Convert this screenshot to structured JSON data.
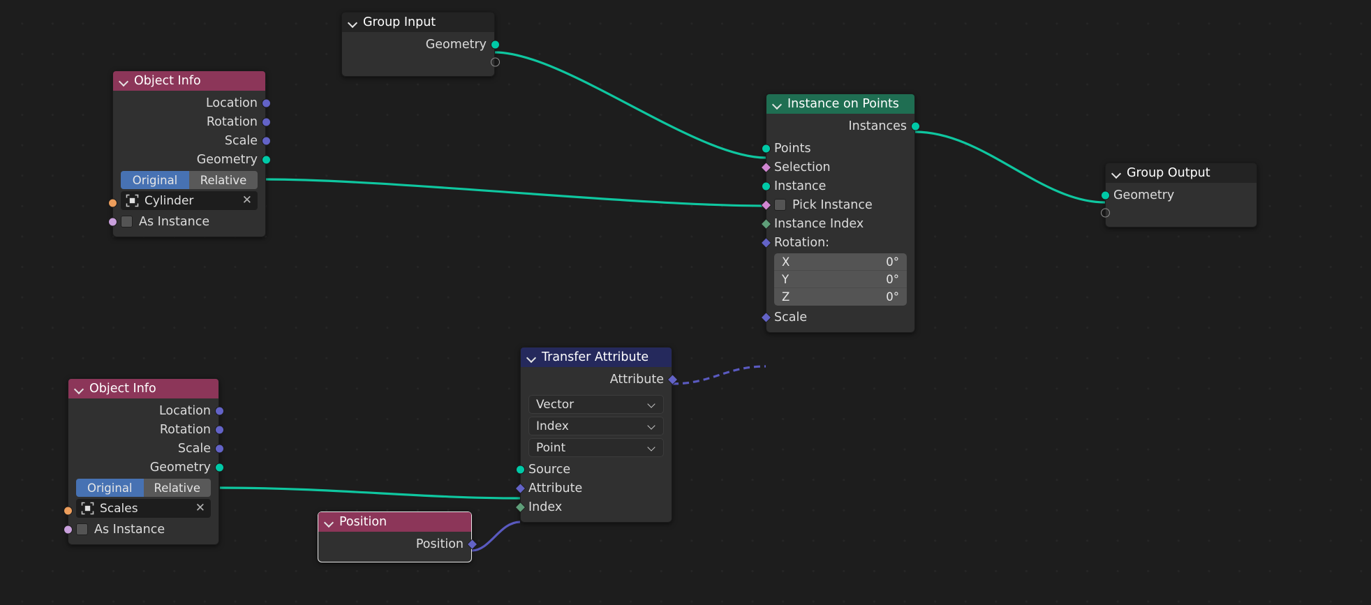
{
  "editor": {
    "name": "Blender Geometry Node Editor",
    "background": "#1d1d1d"
  },
  "colors": {
    "header_input": "#8c3659",
    "header_geometry": "#1f6e52",
    "header_attribute": "#25295c",
    "header_group": "#232323",
    "socket_geometry": "#00c9a7",
    "socket_vector": "#6363c7",
    "socket_field_vector": "#6363c7",
    "socket_bool": "#d186d1",
    "socket_int": "#5f9e79",
    "socket_object": "#ed9e5c",
    "socket_instance": "#c9a0dc",
    "link_geometry": "#0fc7a0",
    "link_field": "#5a5ac0",
    "toggle_active": "#4772b3"
  },
  "nodes": {
    "group_input": {
      "title": "Group Input",
      "outputs": [
        {
          "label": "Geometry",
          "socket": "socket_geometry",
          "shape": "circle"
        },
        {
          "label": "",
          "socket": "ring",
          "shape": "ring"
        }
      ]
    },
    "object_info_top": {
      "title": "Object Info",
      "outputs": [
        {
          "label": "Location",
          "socket": "socket_vector",
          "shape": "circle"
        },
        {
          "label": "Rotation",
          "socket": "socket_vector",
          "shape": "circle"
        },
        {
          "label": "Scale",
          "socket": "socket_vector",
          "shape": "circle"
        },
        {
          "label": "Geometry",
          "socket": "socket_geometry",
          "shape": "circle"
        }
      ],
      "transform_space": {
        "options": [
          "Original",
          "Relative"
        ],
        "selected": "Original"
      },
      "object_field": {
        "icon": "object-icon",
        "value": "Cylinder",
        "clear": "✕",
        "socket": "socket_object"
      },
      "as_instance": {
        "label": "As Instance",
        "checked": false,
        "socket": "socket_instance"
      }
    },
    "object_info_bottom": {
      "title": "Object Info",
      "outputs": [
        {
          "label": "Location",
          "socket": "socket_vector",
          "shape": "circle"
        },
        {
          "label": "Rotation",
          "socket": "socket_vector",
          "shape": "circle"
        },
        {
          "label": "Scale",
          "socket": "socket_vector",
          "shape": "circle"
        },
        {
          "label": "Geometry",
          "socket": "socket_geometry",
          "shape": "circle"
        }
      ],
      "transform_space": {
        "options": [
          "Original",
          "Relative"
        ],
        "selected": "Original"
      },
      "object_field": {
        "icon": "object-icon",
        "value": "Scales",
        "clear": "✕",
        "socket": "socket_object"
      },
      "as_instance": {
        "label": "As Instance",
        "checked": false,
        "socket": "socket_instance"
      }
    },
    "instance_on_points": {
      "title": "Instance on Points",
      "outputs": [
        {
          "label": "Instances",
          "socket": "socket_geometry",
          "shape": "circle"
        }
      ],
      "inputs": [
        {
          "label": "Points",
          "socket": "socket_geometry",
          "shape": "circle"
        },
        {
          "label": "Selection",
          "socket": "socket_bool",
          "shape": "diamond"
        },
        {
          "label": "Instance",
          "socket": "socket_geometry",
          "shape": "circle"
        },
        {
          "label": "Pick Instance",
          "socket": "socket_bool",
          "shape": "diamond",
          "checkbox": false
        },
        {
          "label": "Instance Index",
          "socket": "socket_int",
          "shape": "diamond"
        },
        {
          "label": "Rotation:",
          "socket": "socket_vector",
          "shape": "diamond"
        }
      ],
      "rotation_values": [
        {
          "axis": "X",
          "value": "0°"
        },
        {
          "axis": "Y",
          "value": "0°"
        },
        {
          "axis": "Z",
          "value": "0°"
        }
      ],
      "scale_input": {
        "label": "Scale",
        "socket": "socket_vector",
        "shape": "diamond"
      }
    },
    "transfer_attribute": {
      "title": "Transfer Attribute",
      "outputs": [
        {
          "label": "Attribute",
          "socket": "socket_vector",
          "shape": "diamond"
        }
      ],
      "dropdowns": [
        {
          "name": "data-type",
          "value": "Vector"
        },
        {
          "name": "mapping",
          "value": "Index"
        },
        {
          "name": "domain",
          "value": "Point"
        }
      ],
      "inputs": [
        {
          "label": "Source",
          "socket": "socket_geometry",
          "shape": "circle"
        },
        {
          "label": "Attribute",
          "socket": "socket_vector",
          "shape": "diamond"
        },
        {
          "label": "Index",
          "socket": "socket_int",
          "shape": "diamond"
        }
      ]
    },
    "position": {
      "title": "Position",
      "outputs": [
        {
          "label": "Position",
          "socket": "socket_vector",
          "shape": "diamond"
        }
      ]
    },
    "group_output": {
      "title": "Group Output",
      "inputs": [
        {
          "label": "Geometry",
          "socket": "socket_geometry",
          "shape": "circle"
        },
        {
          "label": "",
          "socket": "ring",
          "shape": "ring"
        }
      ]
    }
  }
}
